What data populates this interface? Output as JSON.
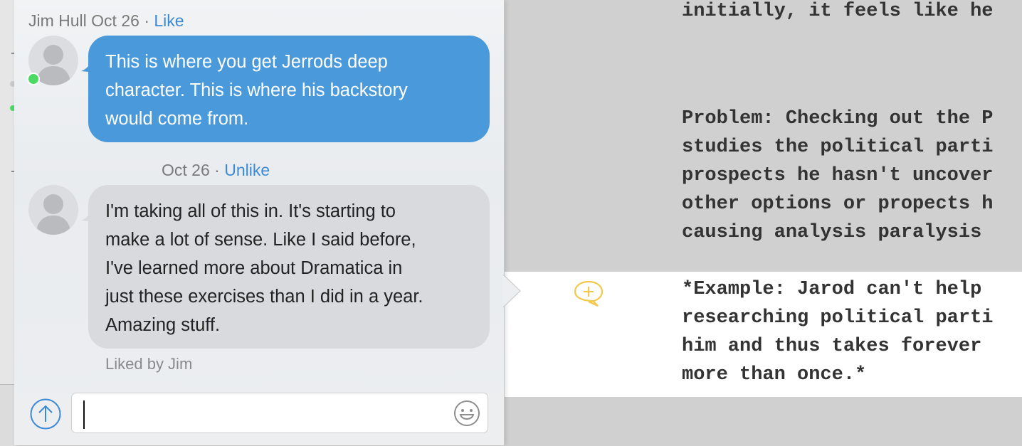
{
  "comments": [
    {
      "author": "Jim Hull",
      "date": "Oct 26",
      "separator": "·",
      "action": "Like",
      "lines": [
        "This is where you get Jerrods deep",
        "character. This is where his backstory",
        "would come from."
      ],
      "online": true
    },
    {
      "author": "",
      "date": "Oct 26",
      "separator": "·",
      "action": "Unlike",
      "lines": [
        "I'm taking all of this in. It's starting to",
        "make a lot of sense. Like I said before,",
        "I've learned more about Dramatica in",
        "just these exercises than I did in a year.",
        "Amazing stuff."
      ],
      "liked_by": "Liked by Jim"
    }
  ],
  "composer": {
    "placeholder": "",
    "value": ""
  },
  "editor": {
    "lines": [
      "initially, it feels like he",
      "Problem: Checking out the P",
      "studies the political parti",
      "prospects he hasn't uncover",
      "other options or propects h",
      "causing analysis paralysis",
      "*Example: Jarod can't help",
      "researching political parti",
      "him and thus takes forever",
      "more than once.*"
    ]
  },
  "colors": {
    "bubble_blue": "#4a99da",
    "bubble_gray": "#d9dadd",
    "link": "#3c8ad6",
    "online": "#4cd964",
    "comment_icon": "#f2c94c"
  }
}
